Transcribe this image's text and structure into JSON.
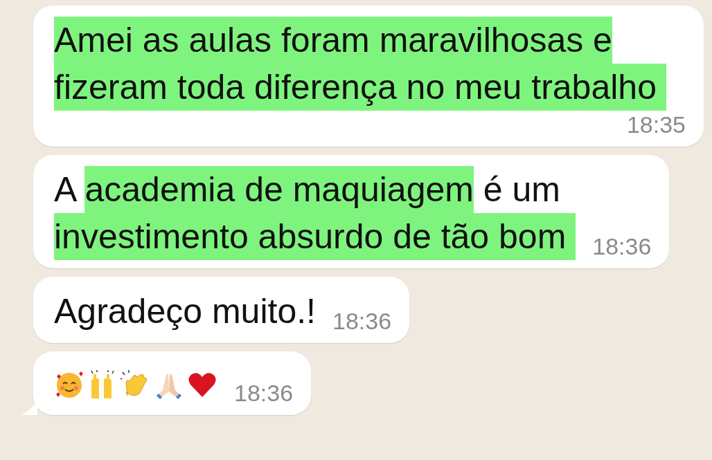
{
  "messages": [
    {
      "lines": [
        [
          {
            "text": "Amei as aulas foram maravilhosas e",
            "highlighted": true
          }
        ],
        [
          {
            "text": "fizeram toda diferença no meu trabalho ",
            "highlighted": true
          }
        ]
      ],
      "time": "18:35"
    },
    {
      "lines": [
        [
          {
            "text": "A ",
            "highlighted": false
          },
          {
            "text": "academia de maquiagem",
            "highlighted": true
          },
          {
            "text": " é um",
            "highlighted": false
          }
        ],
        [
          {
            "text": "investimento absurdo de tão bom ",
            "highlighted": true
          }
        ]
      ],
      "time": "18:36"
    },
    {
      "lines": [
        [
          {
            "text": "Agradeço muito.!",
            "highlighted": false
          }
        ]
      ],
      "time": "18:36"
    },
    {
      "emojis": [
        {
          "kind": "smiling-face-hearts"
        },
        {
          "kind": "raised-hands"
        },
        {
          "kind": "clapping-hands"
        },
        {
          "kind": "praying-hands"
        },
        {
          "kind": "heart"
        }
      ],
      "time": "18:36",
      "tail": true
    }
  ]
}
